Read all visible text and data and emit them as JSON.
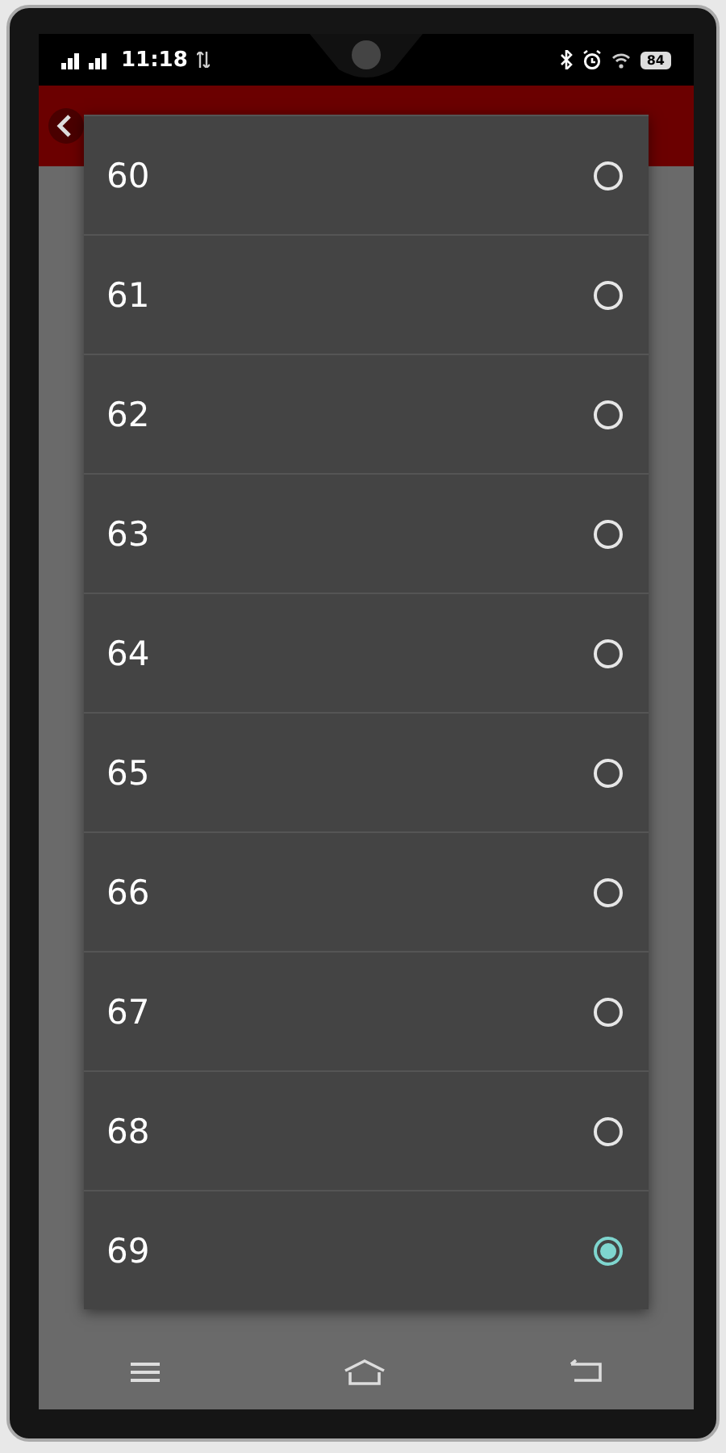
{
  "status_bar": {
    "time": "11:18",
    "battery": "84"
  },
  "options": [
    {
      "label": "60",
      "selected": false
    },
    {
      "label": "61",
      "selected": false
    },
    {
      "label": "62",
      "selected": false
    },
    {
      "label": "63",
      "selected": false
    },
    {
      "label": "64",
      "selected": false
    },
    {
      "label": "65",
      "selected": false
    },
    {
      "label": "66",
      "selected": false
    },
    {
      "label": "67",
      "selected": false
    },
    {
      "label": "68",
      "selected": false
    },
    {
      "label": "69",
      "selected": true
    }
  ]
}
